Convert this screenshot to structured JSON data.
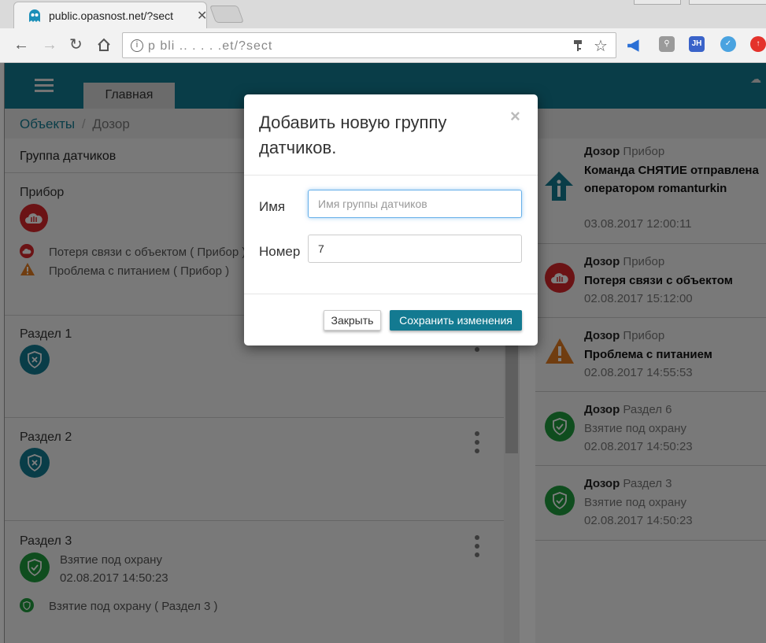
{
  "browser": {
    "tab_title": "public.opasnost.net/?sect",
    "url": "p  bli ..  .  . . .et/?sect"
  },
  "app": {
    "home_tab": "Главная",
    "breadcrumb": {
      "root": "Объекты",
      "separator": "/",
      "current": "Дозор"
    },
    "left_panel": {
      "header": "Группа датчиков",
      "device": {
        "title": "Прибор",
        "events": [
          "Потеря связи с объектом ( Прибор )",
          "Проблема с питанием ( Прибор )"
        ]
      },
      "sections": [
        {
          "title": "Раздел 1"
        },
        {
          "title": "Раздел 2"
        },
        {
          "title": "Раздел 3",
          "status": "Взятие под охрану",
          "time": "02.08.2017 14:50:23",
          "event": "Взятие под охрану ( Раздел 3 )"
        }
      ]
    },
    "right_panel": {
      "items": [
        {
          "object": "Дозор",
          "source": "Прибор",
          "event": "Команда СНЯТИЕ отправлена оператором romanturkin",
          "time": "03.08.2017 12:00:11",
          "icon": "info-arrow-icon",
          "color": "#137a91"
        },
        {
          "object": "Дозор",
          "source": "Прибор",
          "event": "Потеря связи с объектом",
          "time": "02.08.2017 15:12:00",
          "icon": "cloud-offline-icon",
          "color": "#d7262b"
        },
        {
          "object": "Дозор",
          "source": "Прибор",
          "event": "Проблема с питанием",
          "time": "02.08.2017 14:55:53",
          "icon": "warning-icon",
          "color": "#e07b20"
        },
        {
          "object": "Дозор",
          "source": "Раздел 6",
          "event": "Взятие под охрану",
          "time": "02.08.2017 14:50:23",
          "icon": "shield-check-icon",
          "color": "#1f9a3d"
        },
        {
          "object": "Дозор",
          "source": "Раздел 3",
          "event": "Взятие под охрану",
          "time": "02.08.2017 14:50:23",
          "icon": "shield-check-icon",
          "color": "#1f9a3d"
        }
      ]
    }
  },
  "modal": {
    "title": "Добавить новую группу датчиков.",
    "close_symbol": "×",
    "name_label": "Имя",
    "name_placeholder": "Имя группы датчиков",
    "number_label": "Номер",
    "number_value": "7",
    "close_button": "Закрыть",
    "save_button": "Сохранить изменения"
  },
  "colors": {
    "brand": "#137a91",
    "danger": "#d7262b",
    "success": "#1f9a3d",
    "warning": "#e07b20"
  }
}
